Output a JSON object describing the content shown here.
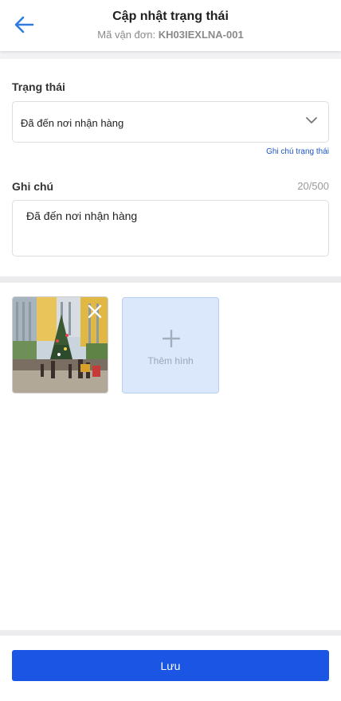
{
  "header": {
    "title": "Cập nhật trạng thái",
    "waybill_label": "Mã vận đơn:",
    "waybill_code": "KH03IEXLNA-001"
  },
  "status": {
    "label": "Trạng thái",
    "selected": "Đã đến nơi nhận hàng",
    "note_link": "Ghi chú trạng thái"
  },
  "note": {
    "label": "Ghi chú",
    "counter": "20/500",
    "value": "Đã đến nơi nhận hàng"
  },
  "photos": {
    "add_label": "Thêm hình"
  },
  "actions": {
    "save_label": "Lưu"
  },
  "colors": {
    "accent": "#1a55e3",
    "link": "#1d56c8",
    "add_photo_bg": "#dbe8fb"
  }
}
